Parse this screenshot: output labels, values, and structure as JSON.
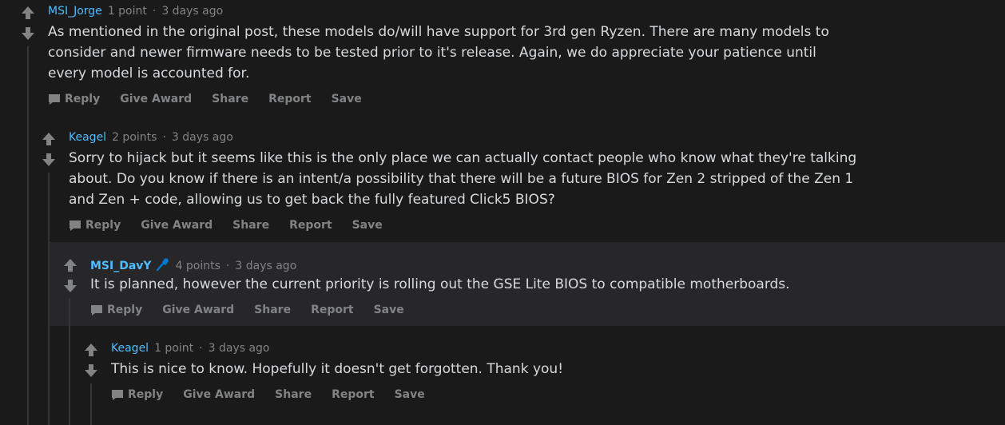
{
  "comments": [
    {
      "author": "MSI_Jorge",
      "points": "1 point",
      "dot": "·",
      "time": "3 days ago",
      "text": "As mentioned in the original post, these models do/will have support for 3rd gen Ryzen. There are many models to consider and newer firmware needs to be tested prior to it's release. Again, we do appreciate your patience until every model is accounted for.",
      "actions": [
        "Reply",
        "Give Award",
        "Share",
        "Report",
        "Save"
      ]
    },
    {
      "author": "Keagel",
      "points": "2 points",
      "dot": "·",
      "time": "3 days ago",
      "text": "Sorry to hijack but it seems like this is the only place we can actually contact people who know what they're talking about. Do you know if there is an intent/a possibility that there will be a future BIOS for Zen 2 stripped of the Zen 1 and Zen + code, allowing us to get back the fully featured Click5 BIOS?",
      "actions": [
        "Reply",
        "Give Award",
        "Share",
        "Report",
        "Save"
      ]
    },
    {
      "author": "MSI_DavY",
      "points": "4 points",
      "dot": "·",
      "time": "3 days ago",
      "text": "It is planned, however the current priority is rolling out the GSE Lite BIOS to compatible motherboards.",
      "actions": [
        "Reply",
        "Give Award",
        "Share",
        "Report",
        "Save"
      ]
    },
    {
      "author": "Keagel",
      "points": "1 point",
      "dot": "·",
      "time": "3 days ago",
      "text": "This is nice to know. Hopefully it doesn't get forgotten. Thank you!",
      "actions": [
        "Reply",
        "Give Award",
        "Share",
        "Report",
        "Save"
      ]
    }
  ],
  "colors": {
    "background": "#1a1a1b",
    "highlight": "#272729",
    "text": "#d7dadc",
    "muted": "#818384",
    "author": "#4fbcff",
    "mod_badge": "#0079d3"
  }
}
